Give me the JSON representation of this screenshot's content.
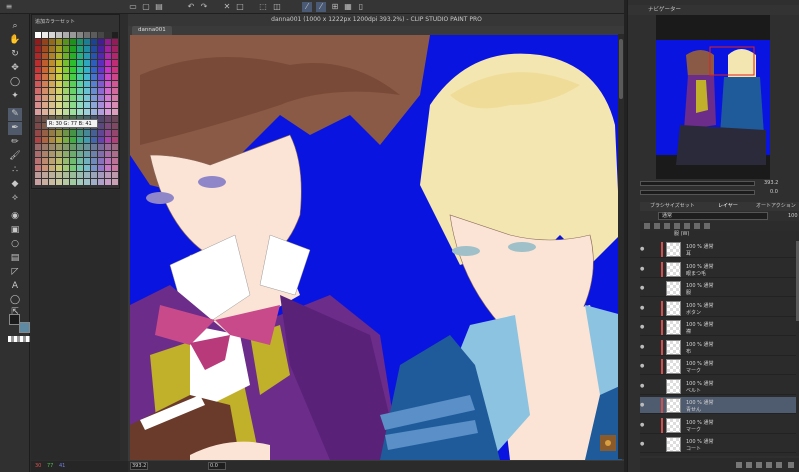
{
  "toolbar": {
    "icons": [
      "menu-icon",
      "new-icon",
      "open-icon",
      "save-icon",
      "undo-icon",
      "redo-icon",
      "erase-icon",
      "clear-icon",
      "transform-icon",
      "snap-icon",
      "ruler-icon",
      "grid-icon",
      "pen-tablet-icon",
      "phone-icon"
    ]
  },
  "document": {
    "title": "danna001 (1000 x 1222px 1200dpi 393.2%)  - CLIP STUDIO PAINT PRO",
    "tab": "danna001"
  },
  "color_panel": {
    "title": "追加カラーセット",
    "rgb_tooltip": "R: 30 G: 77 B: 41"
  },
  "left_status": {
    "r": "30",
    "g": "77",
    "b": "41"
  },
  "status": {
    "zoom": "393.2",
    "rotation": "0.0"
  },
  "navigator": {
    "title": "ナビゲーター",
    "zoom_value": "393.2",
    "rotate_value": "0.0"
  },
  "layer_panel": {
    "tabs": [
      "ブラシサイズセット",
      "レイヤー",
      "オートアクション"
    ],
    "blend_mode": "通常",
    "opacity": "100",
    "group_label": "服 (W)",
    "layers": [
      {
        "pct": "100 % 通常",
        "name": "耳",
        "clip": true
      },
      {
        "pct": "100 % 通常",
        "name": "眼まつ毛",
        "clip": true
      },
      {
        "pct": "100 % 通常",
        "name": "服",
        "clip": false
      },
      {
        "pct": "100 % 通常",
        "name": "ボタン",
        "clip": true
      },
      {
        "pct": "100 % 通常",
        "name": "襟",
        "clip": true
      },
      {
        "pct": "100 % 通常",
        "name": "布",
        "clip": true
      },
      {
        "pct": "100 % 通常",
        "name": "マーク",
        "clip": true
      },
      {
        "pct": "100 % 通常",
        "name": "ベルト",
        "clip": false
      },
      {
        "pct": "100 % 通常",
        "name": "青せん",
        "clip": true,
        "selected": true
      },
      {
        "pct": "100 % 通常",
        "name": "マーク",
        "clip": true
      },
      {
        "pct": "100 % 通常",
        "name": "コート",
        "clip": false
      }
    ]
  },
  "colors": {
    "canvas_bg": "#0a14e0",
    "accent": "#4f5b6e"
  }
}
